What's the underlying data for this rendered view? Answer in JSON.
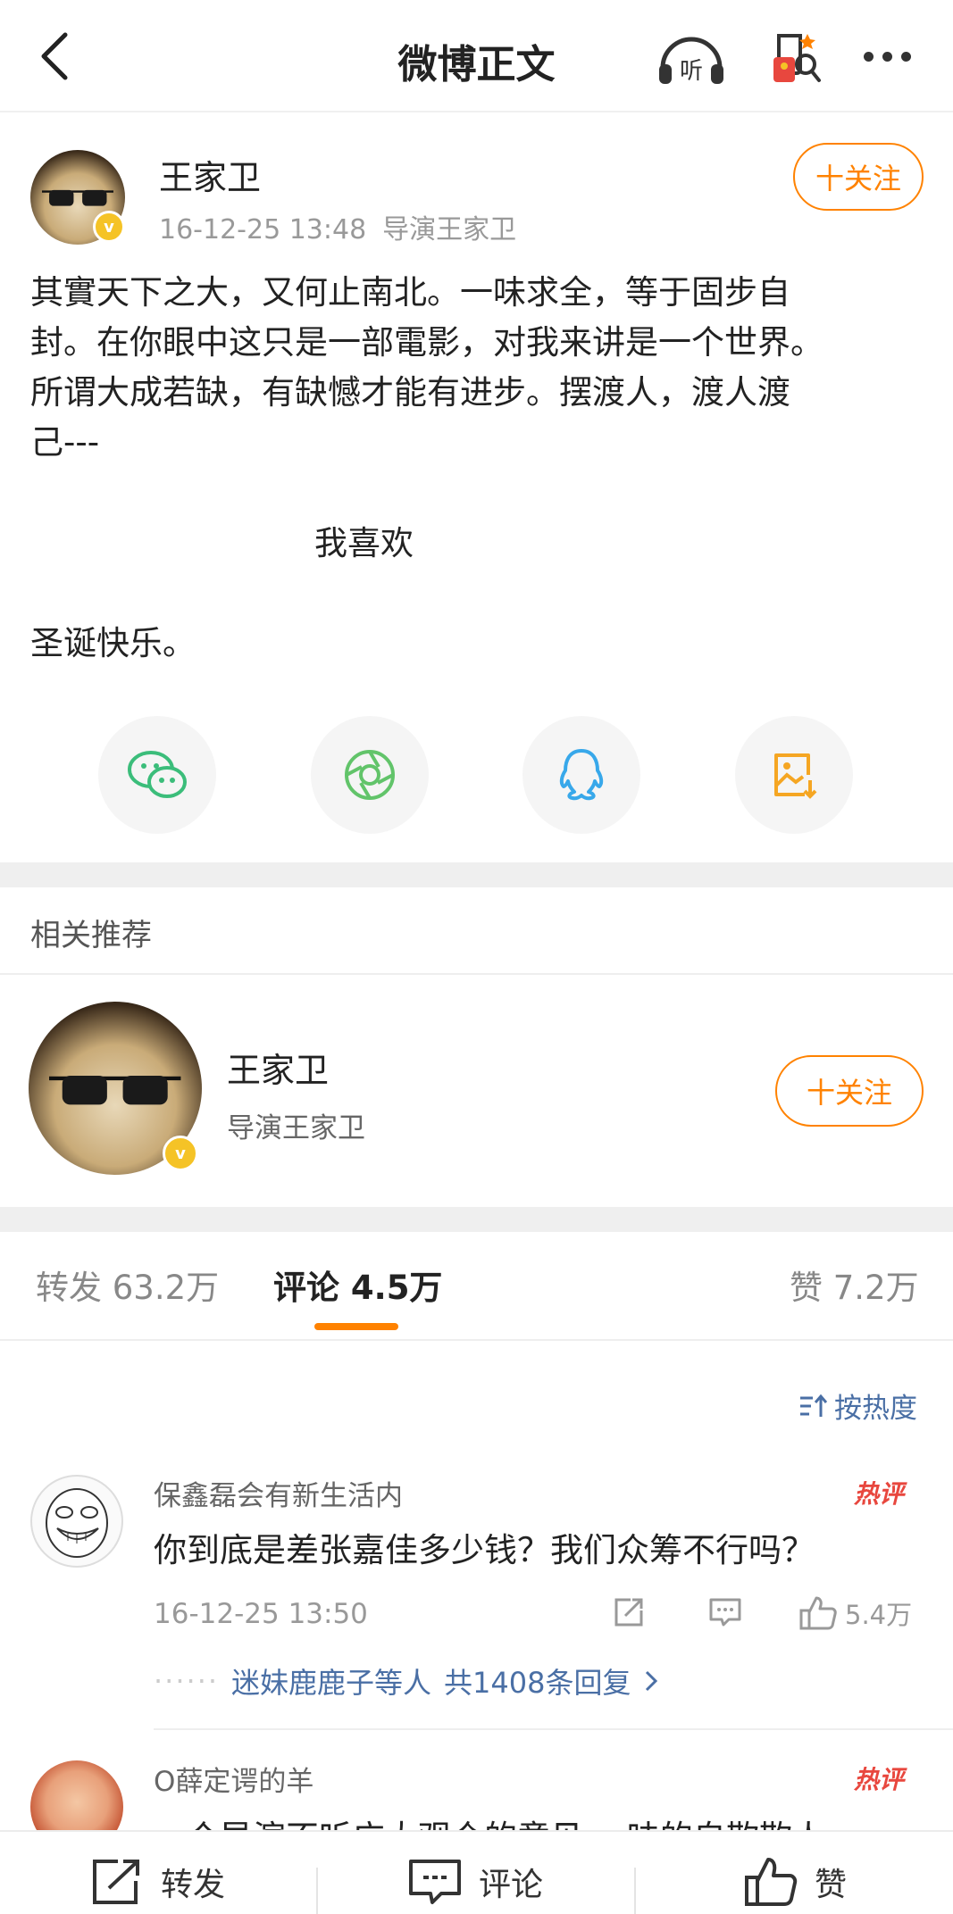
{
  "header": {
    "title": "微博正文"
  },
  "post": {
    "author": "王家卫",
    "time": "16-12-25 13:48",
    "source": "导演王家卫",
    "follow_label": "十关注",
    "body": "其實天下之大，又何止南北。一味求全，等于固步自\n封。在你眼中这只是一部電影，对我来讲是一个世界。\n所谓大成若缺，有缺憾才能有进步。摆渡人，渡人渡\n己---",
    "center_line": "我喜欢",
    "closing_line": "圣诞快乐。"
  },
  "share": {
    "icons": [
      "wechat-icon",
      "moments-icon",
      "qq-icon",
      "save-image-icon"
    ],
    "colors": {
      "wechat": "#3bbd7a",
      "moments": "#62c46a",
      "qq": "#38a8ea",
      "save": "#f5a623"
    }
  },
  "related": {
    "title": "相关推荐",
    "name": "王家卫",
    "desc": "导演王家卫",
    "follow_label": "十关注"
  },
  "tabs": {
    "repost": {
      "label": "转发",
      "count": "63.2万"
    },
    "comment": {
      "label": "评论",
      "count": "4.5万"
    },
    "like": {
      "label": "赞",
      "count": "7.2万"
    }
  },
  "sort_label": "按热度",
  "comments": [
    {
      "user": "保鑫磊会有新生活内",
      "badge": "热评",
      "text": "你到底是差张嘉佳多少钱？我们众筹不行吗？",
      "time": "16-12-25 13:50",
      "likes": "5.4万",
      "reply_users": "迷妹鹿鹿子等人",
      "reply_count": "共1408条回复"
    },
    {
      "user": "O薛定谔的羊",
      "badge": "热评",
      "text": "一个导演不听广大观众的意见 一味的自欺欺人"
    }
  ],
  "bottom_bar": {
    "repost": "转发",
    "comment": "评论",
    "like": "赞"
  },
  "colors": {
    "accent": "#ff8200",
    "link": "#4a6fa5",
    "hot": "#e8473e",
    "verified": "#f5c326"
  }
}
